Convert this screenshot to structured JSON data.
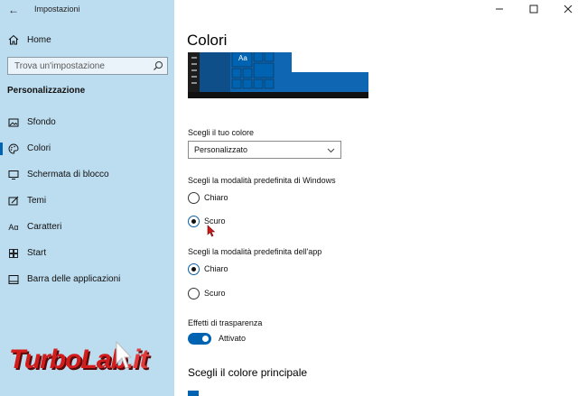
{
  "window": {
    "title": "Impostazioni"
  },
  "sidebar": {
    "home_label": "Home",
    "search_placeholder": "Trova un'impostazione",
    "section_title": "Personalizzazione",
    "items": [
      {
        "label": "Sfondo",
        "icon": "image-icon",
        "active": false
      },
      {
        "label": "Colori",
        "icon": "palette-icon",
        "active": true
      },
      {
        "label": "Schermata di blocco",
        "icon": "lock-screen-icon",
        "active": false
      },
      {
        "label": "Temi",
        "icon": "brush-icon",
        "active": false
      },
      {
        "label": "Caratteri",
        "icon": "font-icon",
        "active": false
      },
      {
        "label": "Start",
        "icon": "start-icon",
        "active": false
      },
      {
        "label": "Barra delle applicazioni",
        "icon": "taskbar-icon",
        "active": false
      }
    ]
  },
  "main": {
    "title": "Colori",
    "preview_tile_text": "Aa",
    "choose_color_label": "Scegli il tuo colore",
    "choose_color_value": "Personalizzato",
    "windows_mode_label": "Scegli la modalità predefinita di Windows",
    "windows_mode_options": [
      {
        "label": "Chiaro",
        "selected": false
      },
      {
        "label": "Scuro",
        "selected": true
      }
    ],
    "app_mode_label": "Scegli la modalità predefinita dell'app",
    "app_mode_options": [
      {
        "label": "Chiaro",
        "selected": true
      },
      {
        "label": "Scuro",
        "selected": false
      }
    ],
    "transparency_label": "Effetti di trasparenza",
    "transparency_value": "Attivato",
    "transparency_on": true,
    "accent_heading": "Scegli il colore principale"
  },
  "colors": {
    "sidebar_bg": "#bcdcef",
    "accent": "#0063b1",
    "preview_bg": "#0a5fa8"
  },
  "watermark": {
    "text_main": "TurboLab",
    "text_suffix": ".it"
  }
}
